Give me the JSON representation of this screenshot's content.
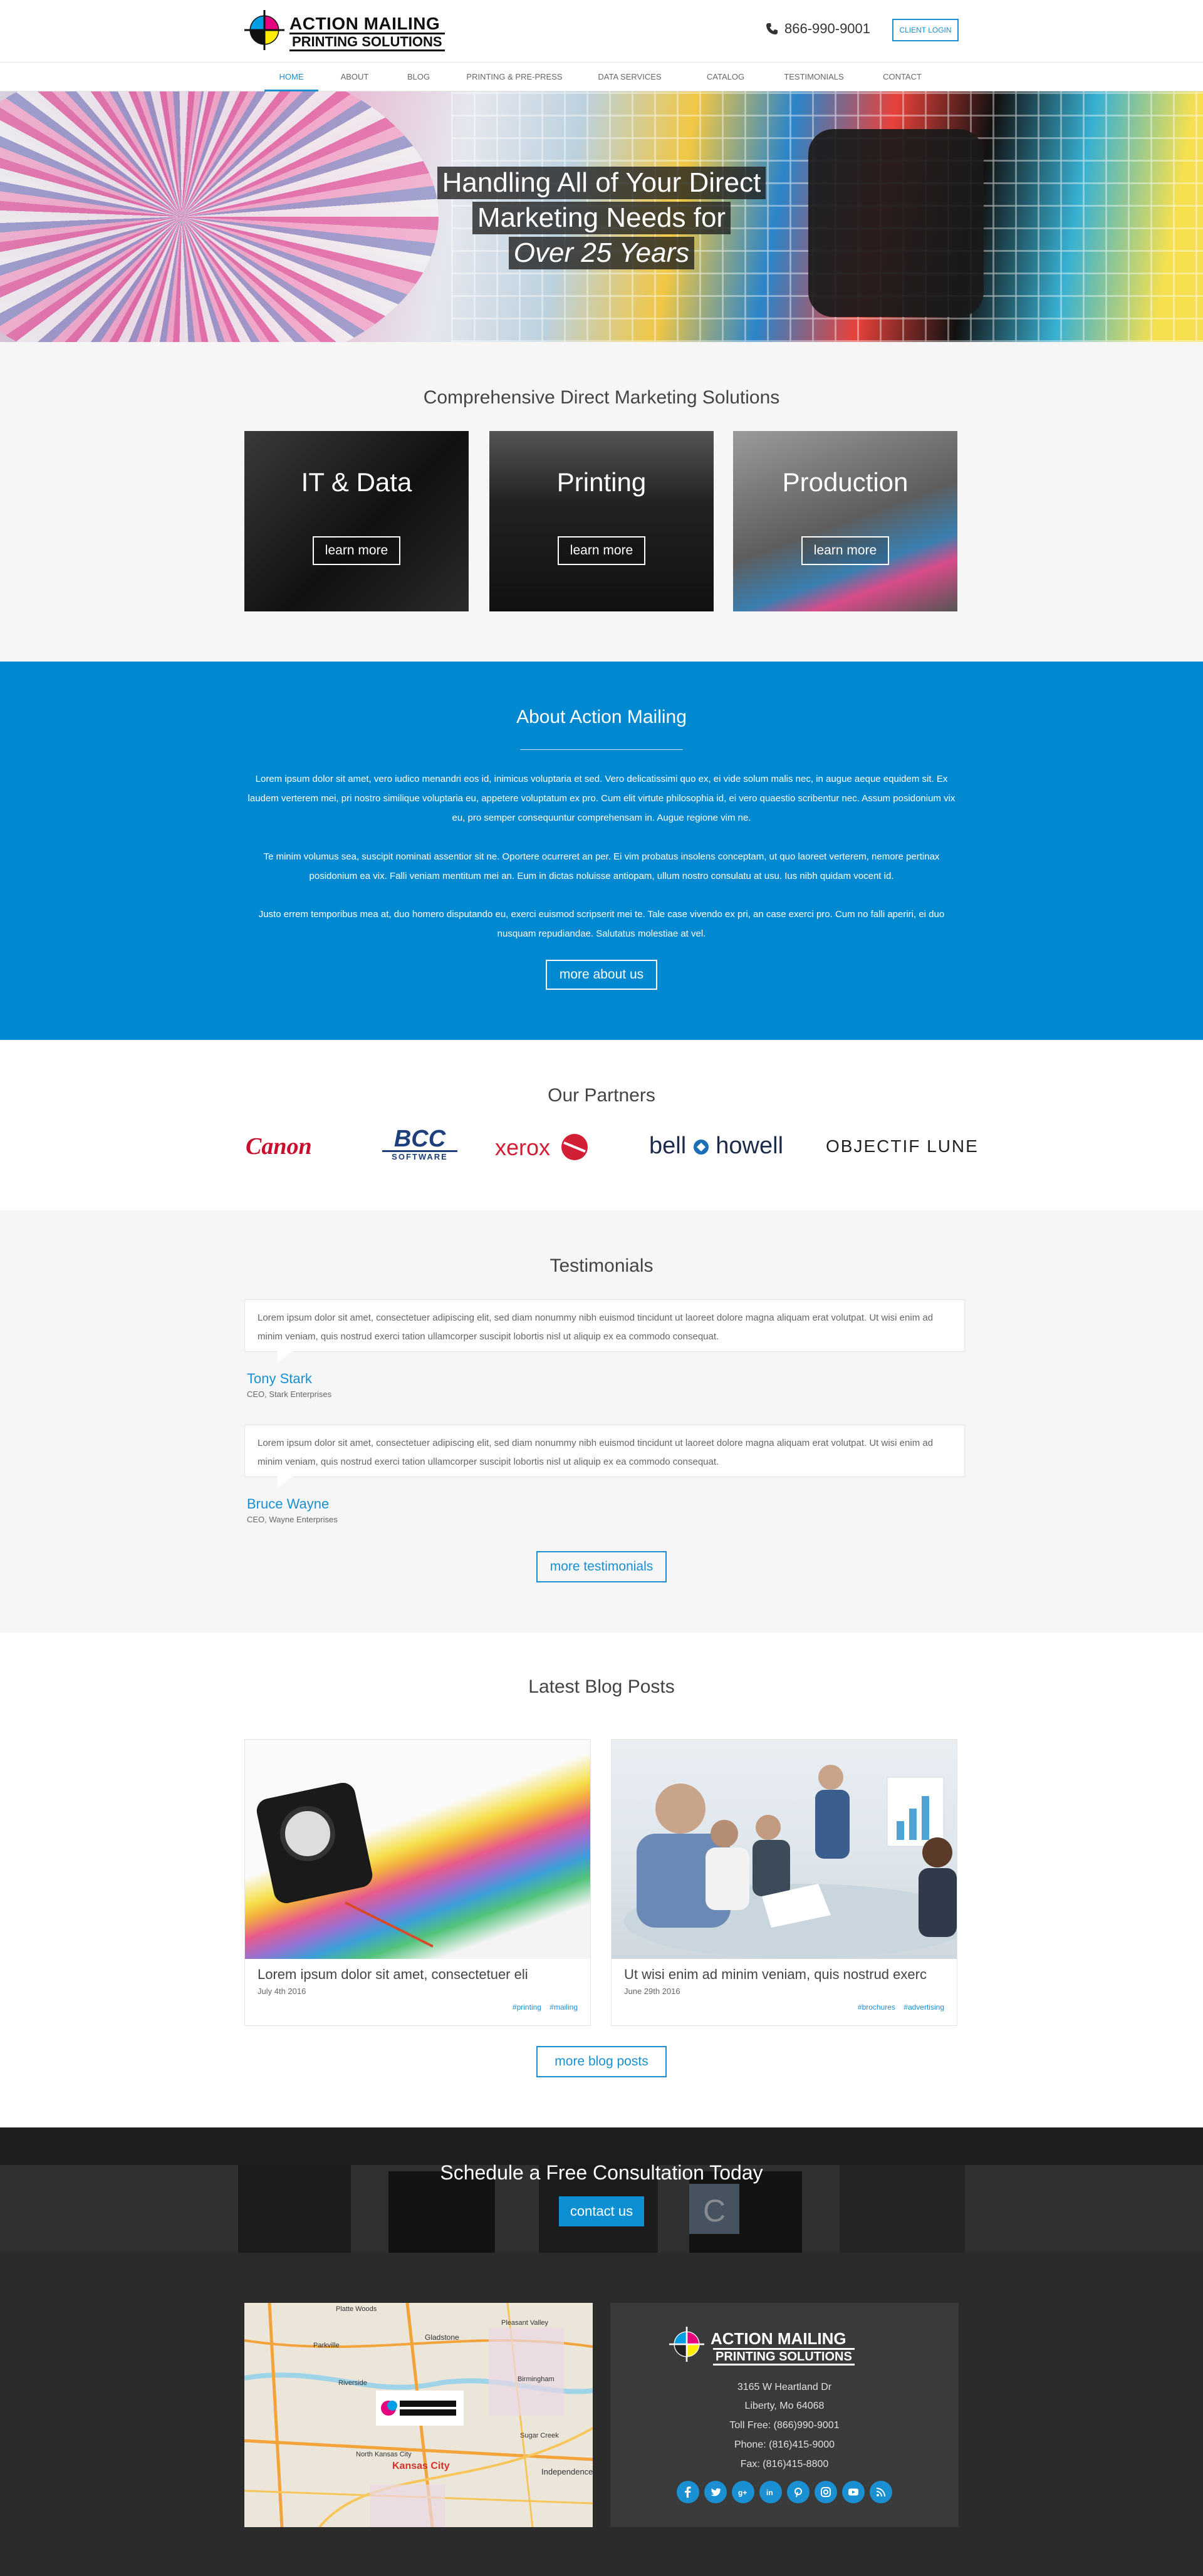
{
  "header": {
    "logo_line1": "ACTION MAILING",
    "logo_line2": "PRINTING SOLUTIONS",
    "phone": "866-990-9001",
    "client_login": "CLIENT LOGIN"
  },
  "nav": {
    "items": [
      "HOME",
      "ABOUT",
      "BLOG",
      "PRINTING & PRE-PRESS",
      "DATA SERVICES",
      "CATALOG",
      "TESTIMONIALS",
      "CONTACT"
    ],
    "active": "HOME"
  },
  "hero": {
    "line1": "Handling All of Your Direct",
    "line2": "Marketing Needs for",
    "line3": "Over 25 Years"
  },
  "solutions": {
    "title": "Comprehensive Direct Marketing Solutions",
    "cards": [
      {
        "heading": "IT & Data",
        "button": "learn more"
      },
      {
        "heading": "Printing",
        "button": "learn more"
      },
      {
        "heading": "Production",
        "button": "learn more"
      }
    ]
  },
  "about": {
    "title": "About Action Mailing",
    "p1": "Lorem ipsum dolor sit amet, vero iudico menandri eos id, inimicus voluptaria et sed. Vero delicatissimi quo ex, ei vide solum malis nec, in augue aeque equidem sit. Ex laudem verterem mei, pri nostro similique voluptaria eu, appetere voluptatum ex pro. Cum elit virtute philosophia id, ei vero quaestio scribentur nec. Assum posidonium vix eu, pro semper consequuntur comprehensam in. Augue regione vim ne.",
    "p2": "Te minim volumus sea, suscipit nominati assentior sit ne. Oportere ocurreret an per. Ei vim probatus insolens conceptam, ut quo laoreet verterem, nemore pertinax posidonium ea vix. Falli veniam mentitum mei an. Eum in dictas noluisse antiopam, ullum nostro consulatu at usu. Ius nibh quidam vocent id.",
    "p3": "Justo errem temporibus mea at, duo homero disputando eu, exerci euismod scripserit mei te. Tale case vivendo ex pri, an case exerci pro. Cum no falli aperiri, ei duo nusquam repudiandae. Salutatus molestiae at vel.",
    "button": "more about us"
  },
  "partners": {
    "title": "Our Partners",
    "logos": [
      "Canon",
      "BCC",
      "SOFTWARE",
      "xerox",
      "bell",
      "howell",
      "OBJECTIF LUNE"
    ]
  },
  "testimonials": {
    "title": "Testimonials",
    "items": [
      {
        "quote": "Lorem ipsum dolor sit amet, consectetuer adipiscing elit, sed diam nonummy nibh euismod tincidunt ut laoreet dolore magna aliquam erat volutpat. Ut wisi enim ad minim veniam, quis nostrud exerci tation ullamcorper suscipit lobortis nisl ut aliquip ex ea commodo consequat.",
        "name": "Tony Stark",
        "role": "CEO, Stark Enterprises"
      },
      {
        "quote": "Lorem ipsum dolor sit amet, consectetuer adipiscing elit, sed diam nonummy nibh euismod tincidunt ut laoreet dolore magna aliquam erat volutpat. Ut wisi enim ad minim veniam, quis nostrud exerci tation ullamcorper suscipit lobortis nisl ut aliquip ex ea commodo consequat.",
        "name": "Bruce Wayne",
        "role": "CEO, Wayne Enterprises"
      }
    ],
    "button": "more testimonials"
  },
  "blog": {
    "title": "Latest Blog Posts",
    "posts": [
      {
        "title": "Lorem ipsum dolor sit amet, consectetuer eli",
        "date": "July 4th 2016",
        "tags": [
          "#printing",
          "#mailing"
        ]
      },
      {
        "title": "Ut wisi enim ad minim veniam, quis nostrud exerc",
        "date": "June 29th 2016",
        "tags": [
          "#brochures",
          "#advertising"
        ]
      }
    ],
    "button": "more blog posts"
  },
  "cta": {
    "title": "Schedule a Free Consultation Today",
    "button": "contact us"
  },
  "footer": {
    "logo_line1": "ACTION MAILING",
    "logo_line2": "PRINTING SOLUTIONS",
    "address1": "3165 W Heartland Dr",
    "address2": "Liberty, Mo 64068",
    "toll_free": "Toll Free: (866)990-9001",
    "phone": "Phone: (816)415-9000",
    "fax": "Fax: (816)415-8800",
    "map_labels": [
      "Platte Woods",
      "Parkville",
      "Gladstone",
      "Pleasant Valley",
      "Riverside",
      "North Kansas City",
      "Birmingham",
      "Kansas City",
      "Sugar Creek",
      "Independence"
    ],
    "social": [
      "facebook-icon",
      "twitter-icon",
      "google-plus-icon",
      "linkedin-icon",
      "pinterest-icon",
      "instagram-icon",
      "youtube-icon",
      "rss-icon"
    ]
  },
  "colors": {
    "accent": "#0089d0",
    "link": "#1a8fd1",
    "footer_bg": "#2b2b2b"
  }
}
